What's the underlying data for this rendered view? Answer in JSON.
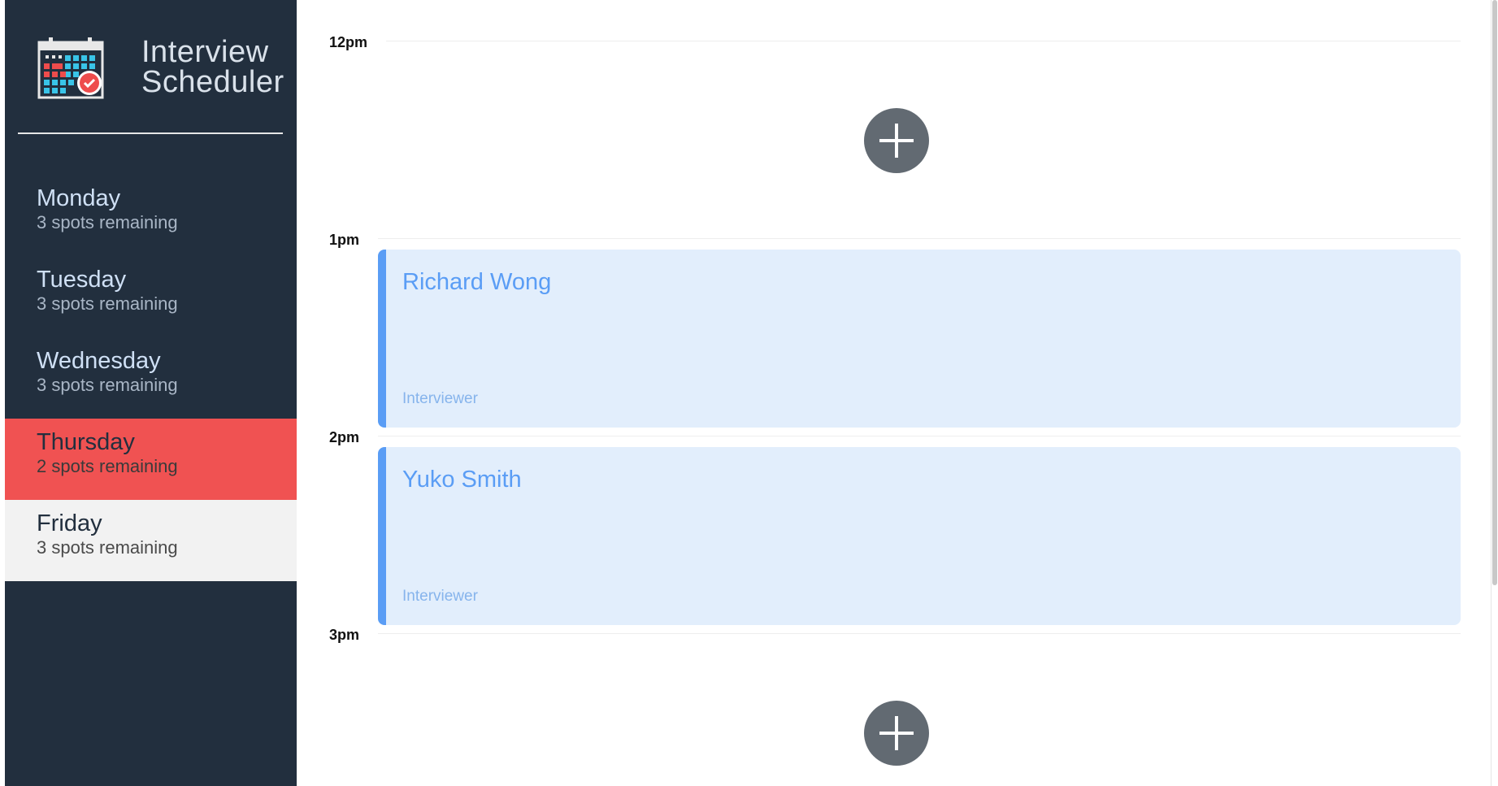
{
  "app": {
    "title_line1": "Interview",
    "title_line2": "Scheduler"
  },
  "days": [
    {
      "name": "Monday",
      "spots": "3 spots remaining",
      "state": "normal"
    },
    {
      "name": "Tuesday",
      "spots": "3 spots remaining",
      "state": "normal"
    },
    {
      "name": "Wednesday",
      "spots": "3 spots remaining",
      "state": "normal"
    },
    {
      "name": "Thursday",
      "spots": "2 spots remaining",
      "state": "selected"
    },
    {
      "name": "Friday",
      "spots": "3 spots remaining",
      "state": "hover"
    }
  ],
  "schedule": {
    "times": [
      "12pm",
      "1pm",
      "2pm",
      "3pm"
    ],
    "appointments": [
      {
        "student": "Richard Wong",
        "interviewer_label": "Interviewer"
      },
      {
        "student": "Yuko Smith",
        "interviewer_label": "Interviewer"
      }
    ],
    "add_icon": "plus-icon"
  },
  "colors": {
    "sidebar_bg": "#222f3e",
    "selected_bg": "#f05252",
    "appointment_bg": "#e2eefc",
    "appointment_accent": "#5a9df5",
    "add_button": "#626a72"
  }
}
